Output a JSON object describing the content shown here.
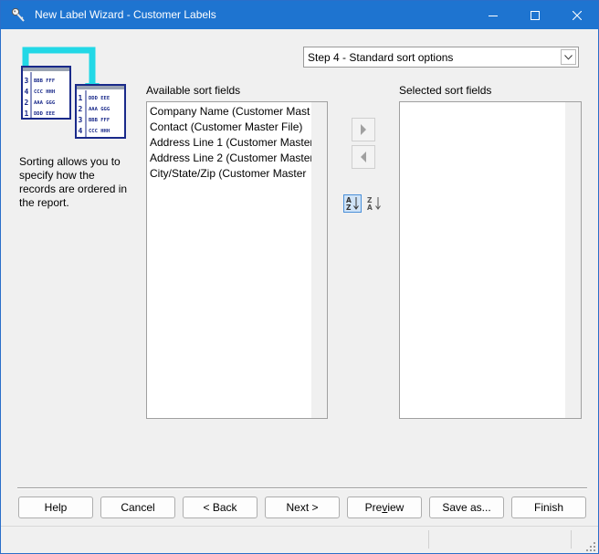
{
  "window": {
    "title": "New Label Wizard - Customer Labels"
  },
  "step_select": {
    "value": "Step 4 - Standard sort options"
  },
  "description": "Sorting allows you to specify how the records are ordered in the report.",
  "available": {
    "label": "Available sort fields",
    "items": [
      "Company Name (Customer Mast",
      "Contact (Customer Master File)",
      "Address Line 1 (Customer Master",
      "Address Line 2 (Customer Master",
      "City/State/Zip (Customer Master"
    ]
  },
  "selected": {
    "label": "Selected sort fields",
    "items": []
  },
  "buttons": {
    "help": "Help",
    "cancel": "Cancel",
    "back": "< Back",
    "next": "Next >",
    "preview_before": "Pre",
    "preview_mnemonic": "v",
    "preview_after": "iew",
    "save_as": "Save as...",
    "finish": "Finish"
  },
  "illustration": {
    "back_sheet": [
      {
        "num": "3",
        "text": "BBB FFF"
      },
      {
        "num": "4",
        "text": "CCC HHH"
      },
      {
        "num": "2",
        "text": "AAA GGG"
      },
      {
        "num": "1",
        "text": "DDD EEE"
      }
    ],
    "front_sheet": [
      {
        "num": "1",
        "text": "DDD EEE"
      },
      {
        "num": "2",
        "text": "AAA GGG"
      },
      {
        "num": "3",
        "text": "BBB FFF"
      },
      {
        "num": "4",
        "text": "CCC HHH"
      }
    ]
  },
  "sort_toggles": {
    "ascending": [
      "A",
      "Z"
    ],
    "descending": [
      "Z",
      "A"
    ]
  },
  "icons": {
    "app": "key-icon",
    "minimize": "minimize-icon",
    "maximize": "maximize-icon",
    "close": "close-icon",
    "move_right": "arrow-right-icon",
    "move_left": "arrow-left-icon",
    "sort_ascending": "sort-ascending-icon",
    "sort_descending": "sort-descending-icon"
  },
  "colors": {
    "titlebar": "#1e74d0",
    "accent_cyan": "#22d8e6",
    "navy": "#1a2a8a",
    "disabled_arrow": "#a0a0a0"
  }
}
